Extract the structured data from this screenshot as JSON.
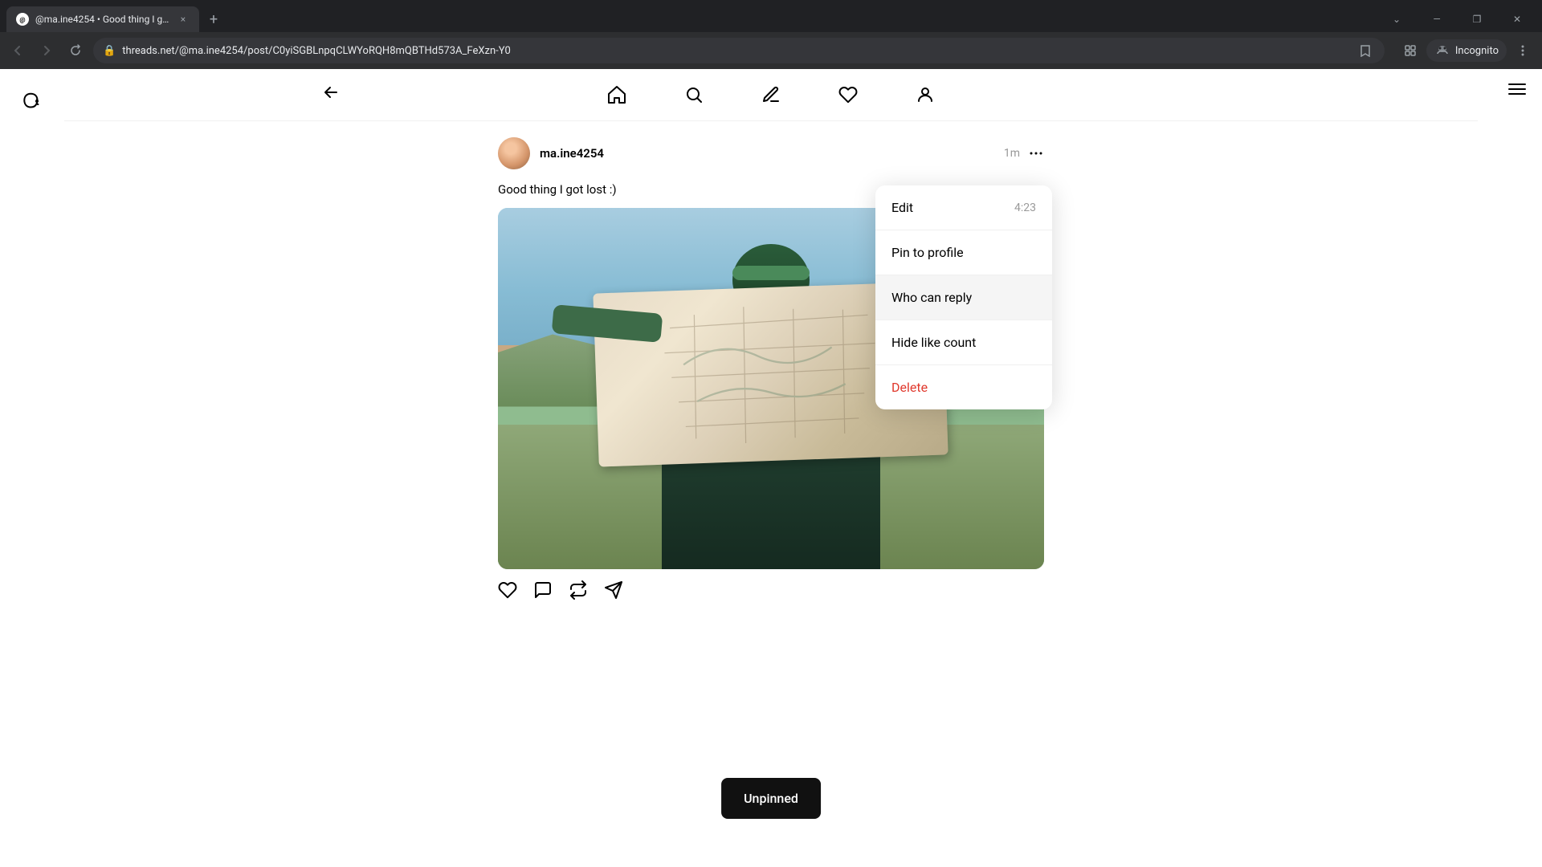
{
  "browser": {
    "tab": {
      "title": "@ma.ine4254 • Good thing I go...",
      "favicon": "T",
      "close_label": "×"
    },
    "new_tab_label": "+",
    "window_controls": {
      "minimize": "—",
      "maximize": "❐",
      "close": "✕"
    },
    "address_bar": {
      "url": "threads.net/@ma.ine4254/post/C0yiSGBLnpqCLWYoRQH8mQBTHd573A_FeXzn-Y0",
      "incognito_label": "Incognito"
    },
    "tab_list_icon": "⌄"
  },
  "page": {
    "logo": "@",
    "nav": {
      "back_icon": "←",
      "home_icon": "⌂",
      "search_icon": "🔍",
      "compose_icon": "✎",
      "activity_icon": "♡",
      "profile_icon": "👤"
    },
    "hamburger_label": "≡"
  },
  "post": {
    "username": "ma.ine4254",
    "time_ago": "1m",
    "more_icon": "•••",
    "content": "Good thing I got lost :)",
    "image_alt": "Person holding a map outdoors"
  },
  "actions": {
    "like_icon": "♡",
    "comment_icon": "💬",
    "repost_icon": "↺",
    "share_icon": "➣"
  },
  "dropdown": {
    "edit_label": "Edit",
    "edit_time": "4:23",
    "pin_label": "Pin to profile",
    "who_can_reply_label": "Who can reply",
    "hide_like_count_label": "Hide like count",
    "delete_label": "Delete"
  },
  "toast": {
    "label": "Unpinned"
  }
}
